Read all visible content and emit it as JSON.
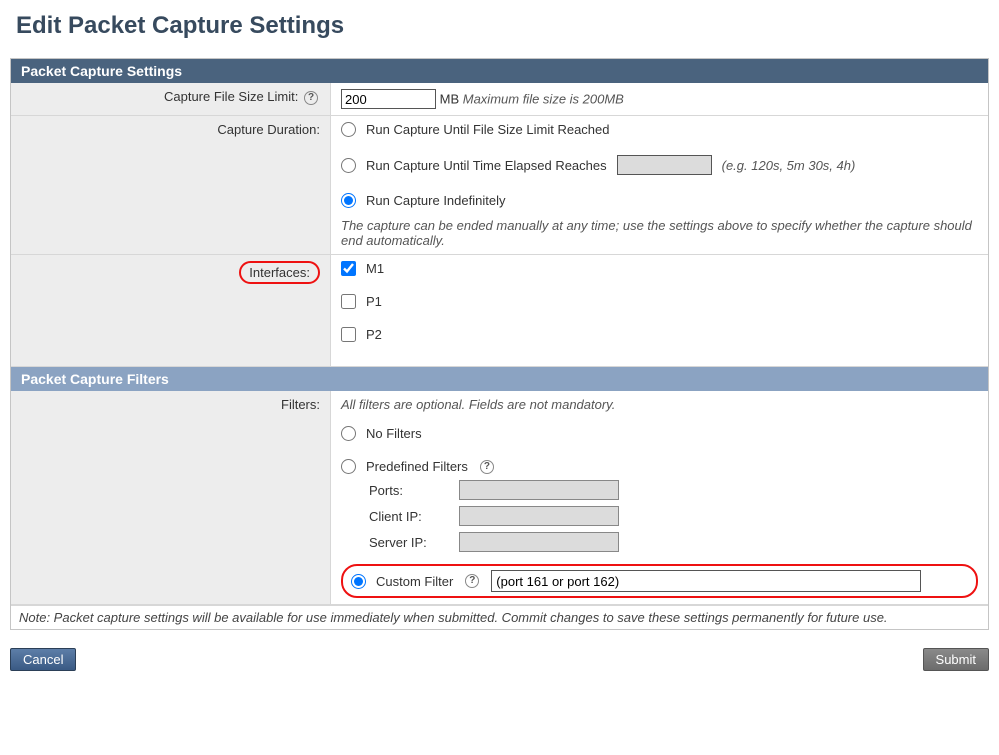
{
  "page_title": "Edit Packet Capture Settings",
  "sections": {
    "settings_header": "Packet Capture Settings",
    "filters_header": "Packet Capture Filters"
  },
  "file_size": {
    "label": "Capture File Size Limit:",
    "value": "200",
    "unit": "MB",
    "hint": "Maximum file size is 200MB"
  },
  "duration": {
    "label": "Capture Duration:",
    "opt_filesize": "Run Capture Until File Size Limit Reached",
    "opt_time": "Run Capture Until Time Elapsed Reaches",
    "time_hint": "(e.g. 120s, 5m 30s, 4h)",
    "opt_indef": "Run Capture Indefinitely",
    "note": "The capture can be ended manually at any time; use the settings above to specify whether the capture should end automatically.",
    "selected": "indef"
  },
  "interfaces": {
    "label": "Interfaces:",
    "items": [
      {
        "name": "M1",
        "checked": true
      },
      {
        "name": "P1",
        "checked": false
      },
      {
        "name": "P2",
        "checked": false
      }
    ]
  },
  "filters": {
    "label": "Filters:",
    "intro": "All filters are optional. Fields are not mandatory.",
    "opt_none": "No Filters",
    "opt_predef": "Predefined Filters",
    "ports_label": "Ports:",
    "clientip_label": "Client IP:",
    "serverip_label": "Server IP:",
    "opt_custom": "Custom Filter",
    "custom_value": "(port 161 or port 162)",
    "selected": "custom"
  },
  "footer_note": "Note: Packet capture settings will be available for use immediately when submitted. Commit changes to save these settings permanently for future use.",
  "buttons": {
    "cancel": "Cancel",
    "submit": "Submit"
  }
}
